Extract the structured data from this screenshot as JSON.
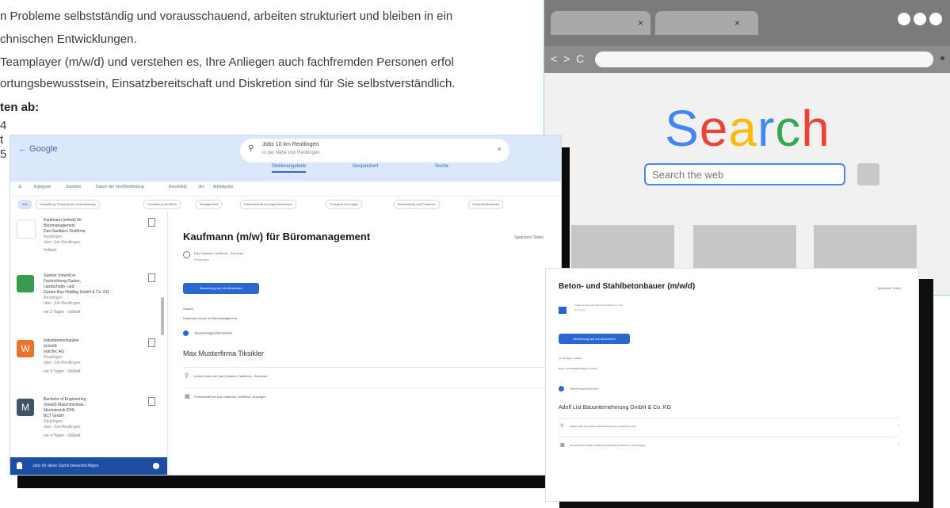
{
  "document": {
    "lines": [
      "n Probleme selbstständig und vorausschauend, arbeiten strukturiert und bleiben in ein",
      "chnischen Entwicklungen.",
      "Teamplayer (m/w/d) und verstehen es, Ihre Anliegen auch fachfremden Personen erfol",
      "ortungsbewusstsein, Einsatzbereitschaft und Diskretion sind für Sie selbstverständlich."
    ],
    "heading": "ten ab:",
    "list_marks": [
      "4",
      "t",
      "5"
    ]
  },
  "browser": {
    "tab_close_icons": [
      "×",
      "×"
    ],
    "nav_glyphs": "< > C",
    "logo_letters": [
      "S",
      "e",
      "a",
      "r",
      "c",
      "h"
    ],
    "logo_colors": [
      "#4285F4",
      "#EA4335",
      "#FBBC05",
      "#4285F4",
      "#34A853",
      "#EA4335"
    ],
    "search_placeholder": "Search the web"
  },
  "job_app": {
    "back_label": "← Google",
    "search_query": "Jobs 10 km Reutlingen",
    "search_sub": "in der Nähe von Reutlingen",
    "header_links": [
      "Stellenangebote",
      "Gespeichert",
      "Suche"
    ],
    "filters": [
      "Kategorie",
      "Standort",
      "Datum der Veröffentlichung",
      "Berufsfeld",
      "Art",
      "Arbeitgeber"
    ],
    "chips": [
      "Alle",
      "Verwaltung, Planung und Unterstützung",
      "Verwaltung und Büro",
      "Management",
      "Wissenschaft und Ingenieurwesen",
      "Transport und Lager",
      "Buchhaltung und Finanzen",
      "Gesundheitswesen"
    ],
    "cards": [
      {
        "lines": [
          "Kaufmann (m/w/d) für",
          "Büromanagement",
          "Das Gastbüro Testfirma",
          "Reutlingen",
          "über: Job-Reutlingen"
        ],
        "badge": "Vollzeit"
      },
      {
        "lines": [
          "Gärtner (m/w/d) in",
          "Fachrichtung Garten,",
          "Landschafts- und",
          "Garten-Bau Holding GmbH & Co. KG",
          "Reutlingen",
          "über: Job-Reutlingen"
        ],
        "badge": "vor 3 Tagen  ·  Vollzeit"
      },
      {
        "lines": [
          "Industriemechaniker",
          "(m/w/d)",
          "IndriTec AG",
          "Reutlingen",
          "über: Job-Reutlingen"
        ],
        "badge": "vor 9 Tagen  ·  Vollzeit"
      },
      {
        "lines": [
          "Bachelor of Engineering",
          "(m/w/d) Maschinenbau -",
          "Mechatronik (DH)",
          "BCT GmbH",
          "Reutlingen",
          "über: Job-Reutlingen"
        ],
        "badge": "vor 4 Tagen  ·  Vollzeit"
      }
    ],
    "card_logo_letters": [
      "",
      "",
      "W",
      "M"
    ],
    "card_logo_colors": [
      "#ffffff",
      "#3a9a4e",
      "#e8752b",
      "#405466"
    ],
    "alert_label": "Jobs für diese Suche benachrichtigen",
    "detail": {
      "title": "Kaufmann (m/w) für Büromanagement",
      "company": "Das Gastbüro Testfirma - Schutzen",
      "location": "Reutlingen",
      "share_label": "Speichern   Teilen",
      "apply_label": "Bewerbung auf Job-Bewerben",
      "meta": "Vollzeit",
      "meta2": "Kaufmann (m/w) für Büromanagement",
      "selected_label": "Bewerbungsportal Denken",
      "firm_heading": "Max Musterfirma Tiksikler",
      "rows": [
        "Andere Jobs bei Das Gastbüro Testfirma - Schutzen",
        "Firmenprofil bei Das Gastbüro Testfirma - anzeigen"
      ]
    }
  },
  "job_detail_2": {
    "title": "Beton- und Stahlbetonbauer (m/w/d)",
    "share_label": "Speichern   Teilen",
    "company": "Adolf List Bauunternehmung GmbH & Co. KG",
    "location": "Reutlingen",
    "apply_label": "Bewerbung auf Job-Bewerben",
    "meta": "vor 10 Tagen  ·  Vollzeit",
    "meta2": "Beton- und Stahlbetonbauer (m/w/d)",
    "selected_label": "Bewerbungsportal Denken",
    "firm_heading": "Adolf List Bauunternehmung GmbH & Co. KG",
    "rows": [
      "Weitere Jobs bei Adolf List Bauunternehmung GmbH & Co. KG",
      "Firmenprofil bei Adolf List Bauunternehmung GmbH & Co. KG anzeigen"
    ]
  }
}
